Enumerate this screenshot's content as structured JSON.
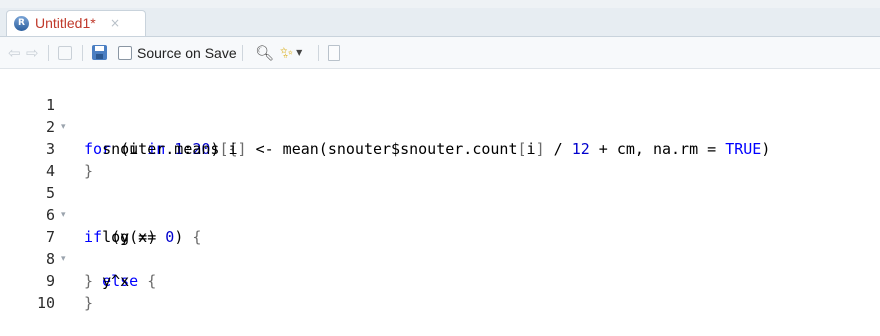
{
  "tab": {
    "label": "Untitled1*",
    "close": "×",
    "r_letter": "R"
  },
  "toolbar": {
    "source_on_save": "Source on Save"
  },
  "editor": {
    "lines": [
      {
        "num": "1",
        "fold": "▾"
      },
      {
        "num": "2"
      },
      {
        "num": "3"
      },
      {
        "num": "4"
      },
      {
        "num": "5",
        "fold": "▾"
      },
      {
        "num": "6"
      },
      {
        "num": "7",
        "fold": "▾"
      },
      {
        "num": "8"
      },
      {
        "num": "9"
      },
      {
        "num": "10"
      }
    ],
    "code": {
      "l1": {
        "for": "for",
        "open": " (i ",
        "in": "in",
        "sp": " ",
        "n1": "1",
        "colon": ":",
        "n20": "20",
        "close": ") ",
        "brace": "{"
      },
      "l2": {
        "indent": "  ",
        "a": "snouter.means",
        "b1": "[",
        "i": "i",
        "b2": "]",
        "arrow": " <- mean(snouter$snouter.count",
        "b3": "[",
        "i2": "i",
        "b4": "]",
        "div": " / ",
        "n12": "12",
        "rest": " + cm, na.rm = ",
        "true": "TRUE",
        "end": ")"
      },
      "l3": {
        "brace": "}"
      },
      "l5": {
        "if": "if",
        "open": " (y == ",
        "zero": "0",
        "close": ") ",
        "brace": "{"
      },
      "l6": {
        "indent": "  ",
        "text": "log(x)"
      },
      "l7": {
        "brace": "}",
        "sp": " ",
        "else": "else",
        "sp2": " ",
        "brace2": "{"
      },
      "l8": {
        "indent": "  ",
        "text": "y^x"
      },
      "l9": {
        "brace": "}"
      }
    }
  },
  "icons": [
    "back-arrow-icon",
    "forward-arrow-icon",
    "show-in-window-icon",
    "save-icon",
    "search-icon",
    "magic-wand-icon",
    "chevron-down-icon",
    "compile-report-icon"
  ]
}
